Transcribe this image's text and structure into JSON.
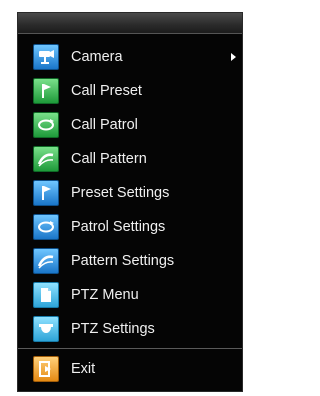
{
  "menu": {
    "items": [
      {
        "label": "Camera",
        "icon": "camera-icon",
        "color": "#2d8ee0",
        "has_submenu": true
      },
      {
        "label": "Call Preset",
        "icon": "flag-icon",
        "color": "#2fb34a"
      },
      {
        "label": "Call Patrol",
        "icon": "patrol-icon",
        "color": "#2fb34a"
      },
      {
        "label": "Call Pattern",
        "icon": "pattern-icon",
        "color": "#2fb34a"
      },
      {
        "label": "Preset Settings",
        "icon": "flag-icon",
        "color": "#2d8ee0"
      },
      {
        "label": "Patrol Settings",
        "icon": "patrol-icon",
        "color": "#2d8ee0"
      },
      {
        "label": "Pattern Settings",
        "icon": "pattern-icon",
        "color": "#2d8ee0"
      },
      {
        "label": "PTZ Menu",
        "icon": "document-icon",
        "color": "#4ab8e8"
      },
      {
        "label": "PTZ Settings",
        "icon": "dome-camera-icon",
        "color": "#4ab8e8"
      },
      {
        "label": "Exit",
        "icon": "exit-icon",
        "color": "#f0a030"
      }
    ]
  }
}
